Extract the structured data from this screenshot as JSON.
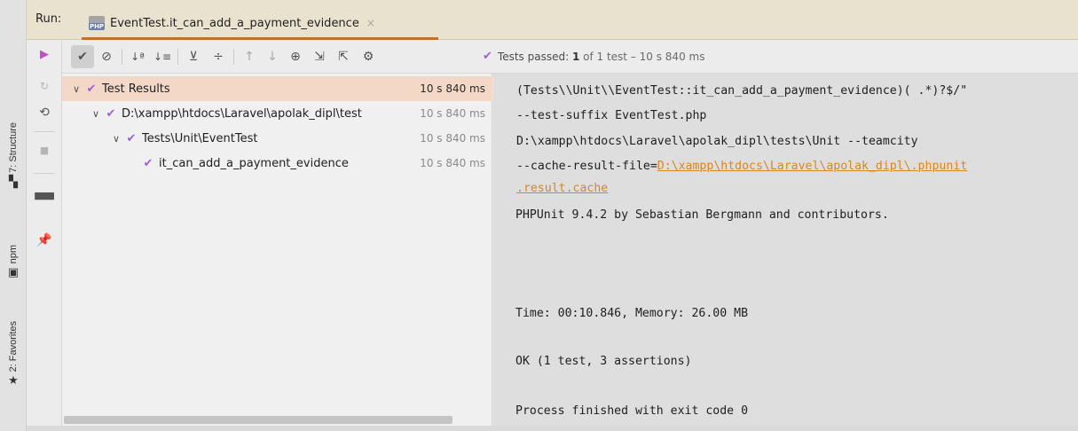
{
  "colors": {
    "check": "#9d5fd3",
    "link": "#d7871f",
    "tab_underline": "#c0712c",
    "selected_row": "#f3d8c7"
  },
  "side_strip": {
    "structure": {
      "label": "7: Structure",
      "icon": "structure-icon"
    },
    "npm": {
      "label": "npm",
      "icon": "npm-icon"
    },
    "favorites": {
      "label": "2: Favorites",
      "icon": "star-icon"
    }
  },
  "header": {
    "run_label": "Run:",
    "tab_title": "EventTest.it_can_add_a_payment_evidence",
    "tab_icon_text": "PHP",
    "tab_close": "×"
  },
  "toolbar": {
    "status_check": "✔",
    "status_prefix": "Tests passed:",
    "status_count": "1",
    "status_rest": "of 1 test – 10 s 840 ms"
  },
  "tree": {
    "rows": [
      {
        "label": "Test Results",
        "time": "10 s 840 ms"
      },
      {
        "label": "D:\\xampp\\htdocs\\Laravel\\apolak_dipl\\test",
        "time": "10 s 840 ms"
      },
      {
        "label": "Tests\\Unit\\EventTest",
        "time": "10 s 840 ms"
      },
      {
        "label": "it_can_add_a_payment_evidence",
        "time": "10 s 840 ms"
      }
    ]
  },
  "console": {
    "line1": "(Tests\\\\Unit\\\\EventTest::it_can_add_a_payment_evidence)( .*)?$/\"",
    "line2": "--test-suffix EventTest.php",
    "line3": "D:\\xampp\\htdocs\\Laravel\\apolak_dipl\\tests\\Unit --teamcity",
    "line4_prefix": "--cache-result-file=",
    "line4_link": "D:\\xampp\\htdocs\\Laravel\\apolak_dipl\\.phpunit",
    "line5_link": ".result.cache",
    "line6": "PHPUnit 9.4.2 by Sebastian Bergmann and contributors.",
    "line7": "Time: 00:10.846, Memory: 26.00 MB",
    "line8": "OK (1 test, 3 assertions)",
    "line9": "Process finished with exit code 0"
  }
}
